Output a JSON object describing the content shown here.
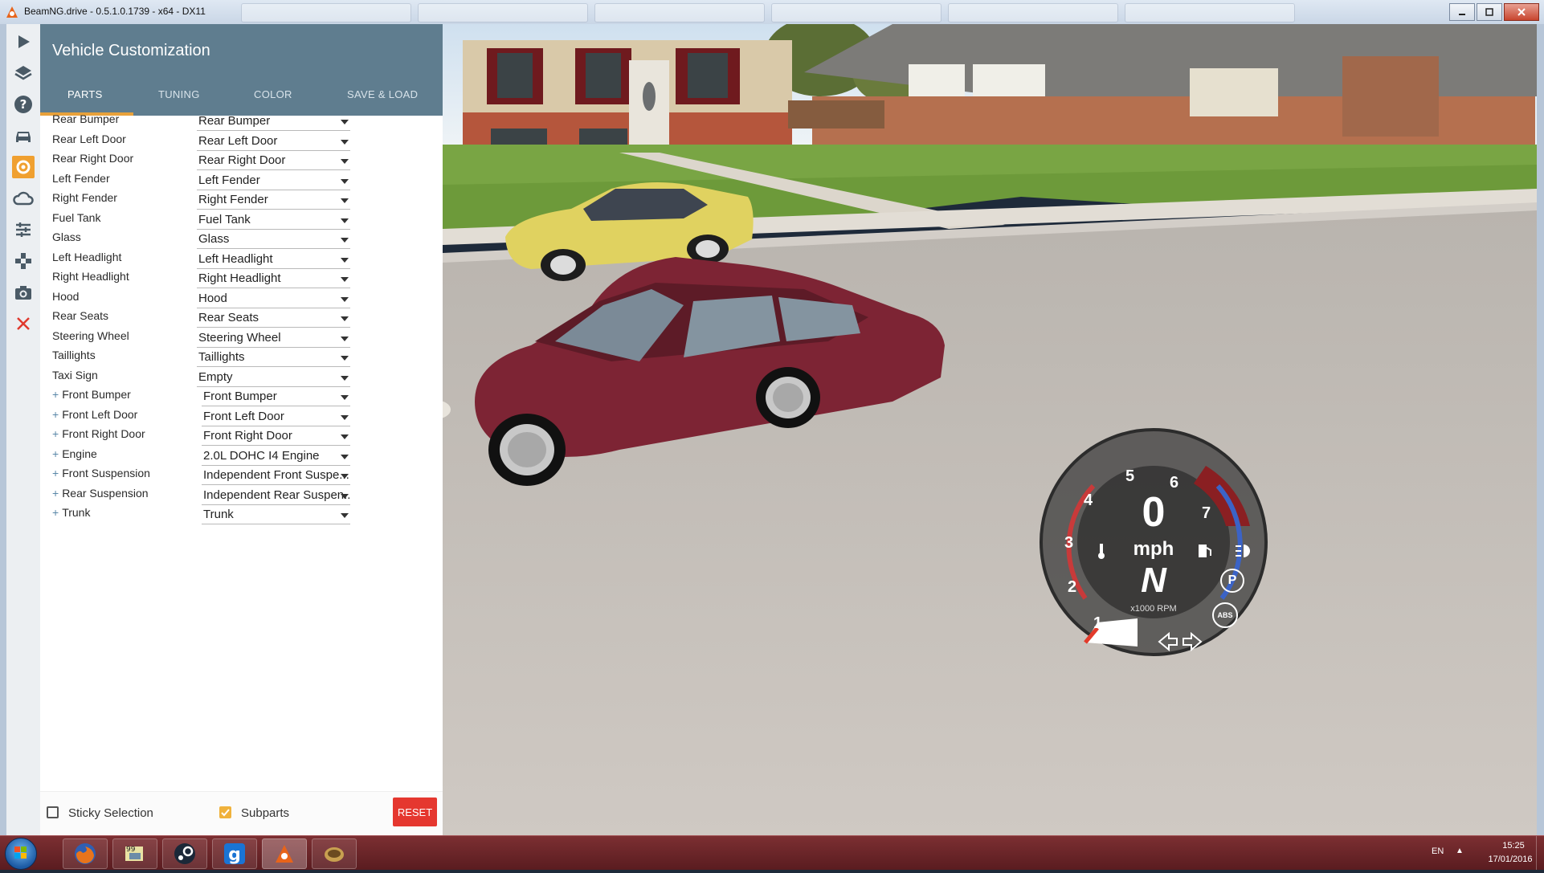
{
  "window": {
    "title": "BeamNG.drive - 0.5.1.0.1739 - x64 - DX11"
  },
  "rail": {
    "icons": [
      "play-icon",
      "layers-icon",
      "help-icon",
      "car-icon",
      "parts-icon",
      "weather-icon",
      "sliders-icon",
      "gamepad-icon",
      "camera-icon",
      "close-icon"
    ]
  },
  "panel": {
    "title": "Vehicle Customization",
    "tabs": [
      "PARTS",
      "TUNING",
      "COLOR",
      "SAVE & LOAD"
    ],
    "active_tab": "PARTS",
    "rows": [
      {
        "label": "Rear Bumper",
        "value": "Rear Bumper",
        "expandable": false
      },
      {
        "label": "Rear Left Door",
        "value": "Rear Left Door",
        "expandable": false
      },
      {
        "label": "Rear Right Door",
        "value": "Rear Right Door",
        "expandable": false
      },
      {
        "label": "Left Fender",
        "value": "Left Fender",
        "expandable": false
      },
      {
        "label": "Right Fender",
        "value": "Right Fender",
        "expandable": false
      },
      {
        "label": "Fuel Tank",
        "value": "Fuel Tank",
        "expandable": false
      },
      {
        "label": "Glass",
        "value": "Glass",
        "expandable": false
      },
      {
        "label": "Left Headlight",
        "value": "Left Headlight",
        "expandable": false
      },
      {
        "label": "Right Headlight",
        "value": "Right Headlight",
        "expandable": false
      },
      {
        "label": "Hood",
        "value": "Hood",
        "expandable": false
      },
      {
        "label": "Rear Seats",
        "value": "Rear Seats",
        "expandable": false
      },
      {
        "label": "Steering Wheel",
        "value": "Steering Wheel",
        "expandable": false
      },
      {
        "label": "Taillights",
        "value": "Taillights",
        "expandable": false
      },
      {
        "label": "Taxi Sign",
        "value": "Empty",
        "expandable": false
      },
      {
        "label": "Front Bumper",
        "value": "Front Bumper",
        "expandable": true
      },
      {
        "label": "Front Left Door",
        "value": "Front Left Door",
        "expandable": true
      },
      {
        "label": "Front Right Door",
        "value": "Front Right Door",
        "expandable": true
      },
      {
        "label": "Engine",
        "value": "2.0L DOHC I4 Engine",
        "expandable": true
      },
      {
        "label": "Front Suspension",
        "value": "Independent Front Suspe...",
        "expandable": true
      },
      {
        "label": "Rear Suspension",
        "value": "Independent Rear Suspen..",
        "expandable": true
      },
      {
        "label": "Trunk",
        "value": "Trunk",
        "expandable": true
      }
    ],
    "footer": {
      "sticky_label": "Sticky Selection",
      "sticky_checked": false,
      "subparts_label": "Subparts",
      "subparts_checked": true,
      "reset_label": "RESET"
    }
  },
  "gauge": {
    "speed": "0",
    "unit": "mph",
    "gear": "N",
    "rpm_label": "x1000 RPM",
    "rpm_ticks": [
      "1",
      "2",
      "3",
      "4",
      "5",
      "6",
      "7"
    ],
    "abs_label": "ABS",
    "parking_label": "P"
  },
  "colors": {
    "panel_header": "#5f7d8f",
    "accent": "#e8a13b",
    "reset": "#e5372f",
    "sedan_body": "#7d2434",
    "taxi_body": "#e0d260"
  },
  "taskbar": {
    "apps": [
      "firefox-icon",
      "tool-icon",
      "steam-icon",
      "gmod-icon",
      "beamng-icon",
      "misc-icon"
    ],
    "language": "EN",
    "time": "15:25",
    "date": "17/01/2016"
  }
}
